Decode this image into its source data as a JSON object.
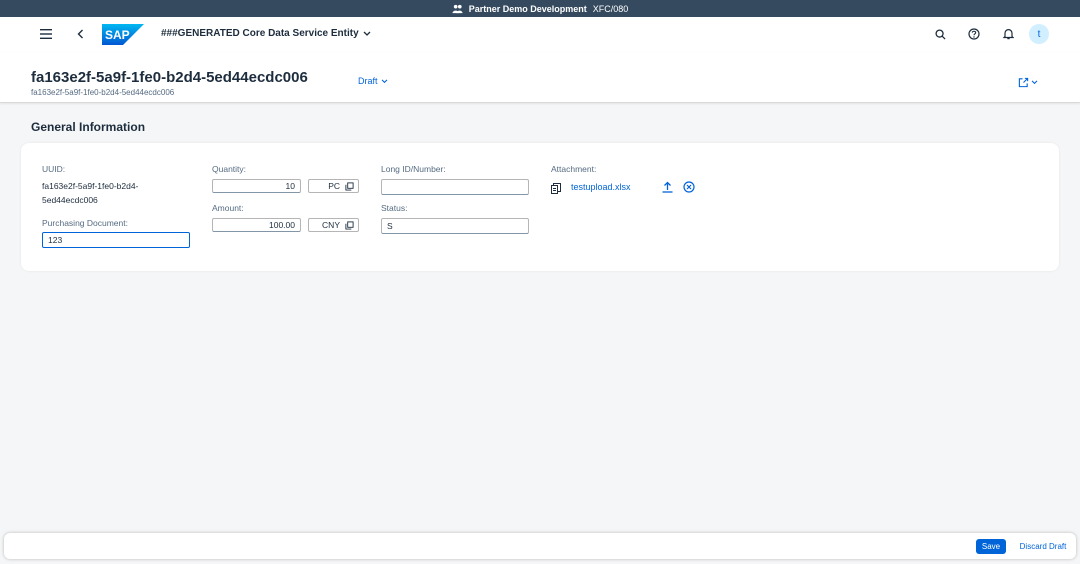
{
  "system_bar": {
    "title": "Partner Demo Development",
    "system": "XFC/080"
  },
  "shell": {
    "app_title": "###GENERATED Core Data Service Entity",
    "logo_text": "SAP",
    "avatar_initial": "t"
  },
  "header": {
    "title": "fa163e2f-5a9f-1fe0-b2d4-5ed44ecdc006",
    "subtitle": "fa163e2f-5a9f-1fe0-b2d4-5ed44ecdc006",
    "draft_label": "Draft"
  },
  "section": {
    "title": "General Information",
    "uuid": {
      "label": "UUID:",
      "value_line1": "fa163e2f-5a9f-1fe0-b2d4-",
      "value_line2": "5ed44ecdc006"
    },
    "purchasing_document": {
      "label": "Purchasing Document:",
      "value": "123"
    },
    "quantity": {
      "label": "Quantity:",
      "value": "10",
      "unit": "PC"
    },
    "amount": {
      "label": "Amount:",
      "value": "100.00",
      "currency": "CNY"
    },
    "long_id": {
      "label": "Long ID/Number:",
      "value": ""
    },
    "status": {
      "label": "Status:",
      "value": "S"
    },
    "attachment": {
      "label": "Attachment:",
      "file_name": "testupload.xlsx"
    }
  },
  "footer": {
    "save_label": "Save",
    "discard_label": "Discard Draft"
  },
  "colors": {
    "brand": "#0064d9",
    "shell_bar": "#354a5f",
    "background": "#f5f6f7"
  }
}
